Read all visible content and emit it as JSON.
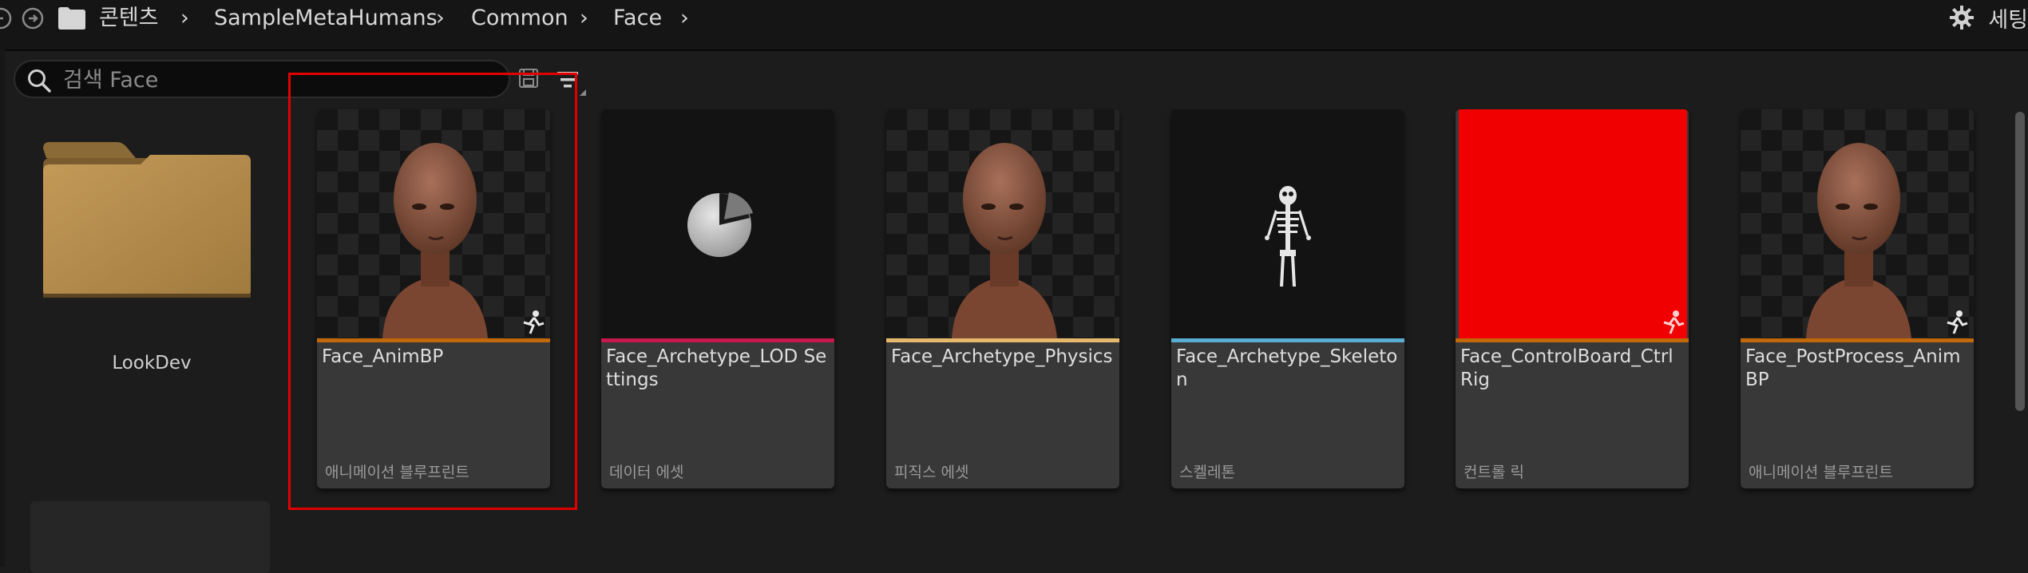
{
  "breadcrumb": {
    "items": [
      "콘텐츠",
      "SampleMetaHumans",
      "Common",
      "Face"
    ]
  },
  "settings": {
    "label": "세팅"
  },
  "search": {
    "placeholder": "검색 Face",
    "value": ""
  },
  "folder": {
    "name": "LookDev"
  },
  "assets": [
    {
      "name": "Face_AnimBP",
      "type": "애니메이션 블루프린트",
      "stripe": "#c0680a",
      "thumb": "head",
      "corner_icon": "anim-blueprint-icon"
    },
    {
      "name": "Face_Archetype_LOD Settings",
      "type": "데이터 에셋",
      "stripe": "#c4194a",
      "thumb": "pie",
      "corner_icon": ""
    },
    {
      "name": "Face_Archetype_Physics",
      "type": "피직스 에셋",
      "stripe": "#e6b86c",
      "thumb": "head",
      "corner_icon": ""
    },
    {
      "name": "Face_Archetype_Skeleton",
      "type": "스켈레톤",
      "stripe": "#5aaed6",
      "thumb": "skeleton",
      "corner_icon": ""
    },
    {
      "name": "Face_ControlBoard_Ctrl Rig",
      "type": "컨트롤 릭",
      "stripe": "#c0680a",
      "thumb": "red",
      "corner_icon": "control-rig-icon"
    },
    {
      "name": "Face_PostProcess_Anim BP",
      "type": "애니메이션 블루프린트",
      "stripe": "#c0680a",
      "thumb": "head",
      "corner_icon": "anim-blueprint-icon"
    }
  ],
  "colors": {
    "selection": "#e00000",
    "background": "#1c1c1c",
    "tile": "#383838",
    "folder": "#b88f4e"
  }
}
